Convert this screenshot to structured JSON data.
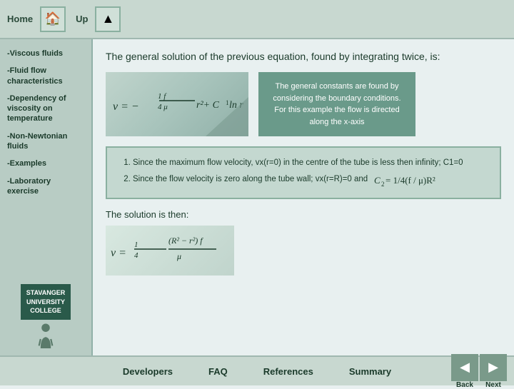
{
  "topbar": {
    "home_label": "Home",
    "up_label": "Up",
    "home_icon": "🏠",
    "up_icon": "▲"
  },
  "sidebar": {
    "items": [
      {
        "id": "viscous-fluids",
        "label": "-Viscous fluids"
      },
      {
        "id": "fluid-flow",
        "label": "-Fluid flow characteristics"
      },
      {
        "id": "dependency",
        "label": "-Dependency of viscosity on temperature"
      },
      {
        "id": "non-newtonian",
        "label": "-Non-Newtonian fluids"
      },
      {
        "id": "examples",
        "label": "-Examples"
      },
      {
        "id": "laboratory",
        "label": "-Laboratory exercise"
      }
    ],
    "logo": {
      "line1": "STAVANGER",
      "line2": "UNIVERSITY",
      "line3": "COLLEGE"
    }
  },
  "content": {
    "main_title": "The general solution of the previous equation, found by integrating twice, is:",
    "tooltip_text": "The general constants are found by considering the boundary conditions. For this example the flow is directed along the x-axis",
    "steps": {
      "step1": "Since the maximum flow velocity, vx(r=0) in the centre of the tube is less then infinity; C1=0",
      "step2": "Since the flow velocity is zero along the tube wall; vx(r=R)=0 and"
    },
    "step2_formula": "C2 = 1/4(f / μ)R²",
    "solution_label": "The solution is then:"
  },
  "bottom": {
    "links": [
      {
        "id": "developers",
        "label": "Developers"
      },
      {
        "id": "faq",
        "label": "FAQ"
      },
      {
        "id": "references",
        "label": "References"
      },
      {
        "id": "summary",
        "label": "Summary"
      }
    ],
    "back_label": "Back",
    "next_label": "Next"
  }
}
